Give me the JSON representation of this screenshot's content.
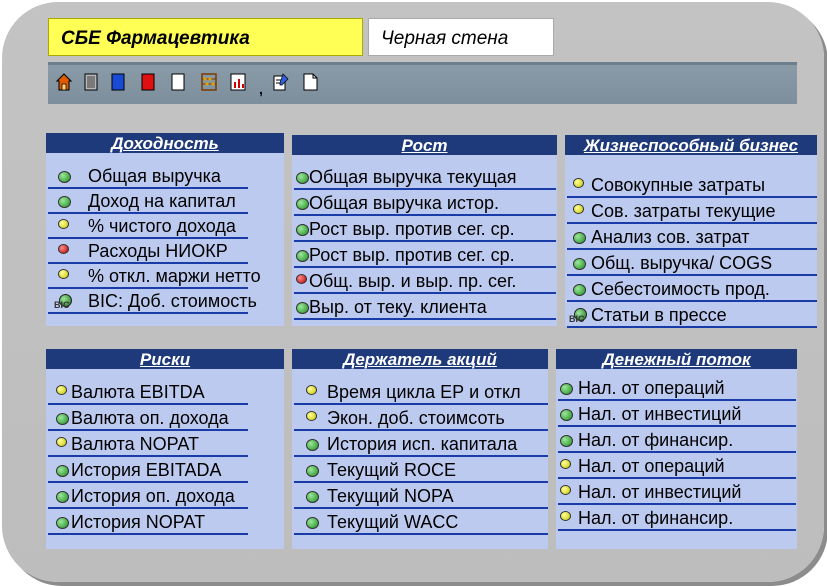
{
  "tabs": {
    "active_label": "СБЕ Фармацевтика",
    "inactive_label": "Черная стена"
  },
  "toolbar": {
    "icons": [
      "home-icon",
      "gray-square-icon",
      "blue-square-icon",
      "red-square-icon",
      "white-square-icon",
      "abacus-icon",
      "chart-icon",
      "separator",
      "edit-icon",
      "document-icon"
    ]
  },
  "colors": {
    "panel_header": "#1f3a7a",
    "panel_body": "#bdcaf0",
    "tab_active": "#ffff55",
    "indicator_green": "#1e8a1e",
    "indicator_yellow": "#c6c600",
    "indicator_red": "#b00000"
  },
  "panels": {
    "income": {
      "title": "Доходность",
      "items": [
        {
          "label": "Общая выручка",
          "status": "green"
        },
        {
          "label": "Доход на капитал",
          "status": "green"
        },
        {
          "label": "% чистого дохода",
          "status": "yellow"
        },
        {
          "label": "Расходы НИОКР",
          "status": "red"
        },
        {
          "label": "% откл. маржи нетто",
          "status": "yellow"
        },
        {
          "label": "BIC: Доб. стоимость",
          "status": "bic"
        }
      ]
    },
    "growth": {
      "title": "Рост",
      "items": [
        {
          "label": "Общая выручка текущая",
          "status": "green"
        },
        {
          "label": "Общая выручка истор.",
          "status": "green"
        },
        {
          "label": "Рост выр. против сег. ср.",
          "status": "green"
        },
        {
          "label": "Рост выр. против сег. ср.",
          "status": "green"
        },
        {
          "label": "Общ. выр. и выр. пр. сег.",
          "status": "red"
        },
        {
          "label": "Выр. от теку. клиента",
          "status": "green"
        }
      ]
    },
    "viable": {
      "title": "Жизнеспособный бизнес",
      "items": [
        {
          "label": "Совокупные затраты",
          "status": "yellow"
        },
        {
          "label": "Сов. затраты текущие",
          "status": "yellow"
        },
        {
          "label": "Анализ сов. затрат",
          "status": "green"
        },
        {
          "label": "Общ. выручка/ COGS",
          "status": "green"
        },
        {
          "label": "Себестоимость прод.",
          "status": "green"
        },
        {
          "label": "Статьи в прессе",
          "status": "bic"
        }
      ]
    },
    "risks": {
      "title": "Риски",
      "items": [
        {
          "label": "Валюта EBITDA",
          "status": "yellow"
        },
        {
          "label": "Валюта оп. дохода",
          "status": "green"
        },
        {
          "label": "Валюта NOPAT",
          "status": "yellow"
        },
        {
          "label": "История EBITADA",
          "status": "green"
        },
        {
          "label": "История оп. дохода",
          "status": "green"
        },
        {
          "label": "История NOPAT",
          "status": "green"
        }
      ]
    },
    "shareholder": {
      "title": "Держатель акций",
      "items": [
        {
          "label": "Время цикла ЕР и откл",
          "status": "yellow"
        },
        {
          "label": "Экон. доб. стоимсоть",
          "status": "yellow"
        },
        {
          "label": "История исп. капитала",
          "status": "green"
        },
        {
          "label": "Текущий ROCE",
          "status": "green"
        },
        {
          "label": "Текущий NOPA",
          "status": "green"
        },
        {
          "label": "Текущий WACC",
          "status": "green"
        }
      ]
    },
    "cashflow": {
      "title": "Денежный поток",
      "items": [
        {
          "label": "Нал. от операций",
          "status": "green"
        },
        {
          "label": "Нал. от инвестиций",
          "status": "green"
        },
        {
          "label": "Нал. от финансир.",
          "status": "green"
        },
        {
          "label": "Нал. от операций",
          "status": "yellow"
        },
        {
          "label": "Нал. от инвестиций",
          "status": "yellow"
        },
        {
          "label": "Нал. от финансир.",
          "status": "yellow"
        }
      ]
    }
  }
}
